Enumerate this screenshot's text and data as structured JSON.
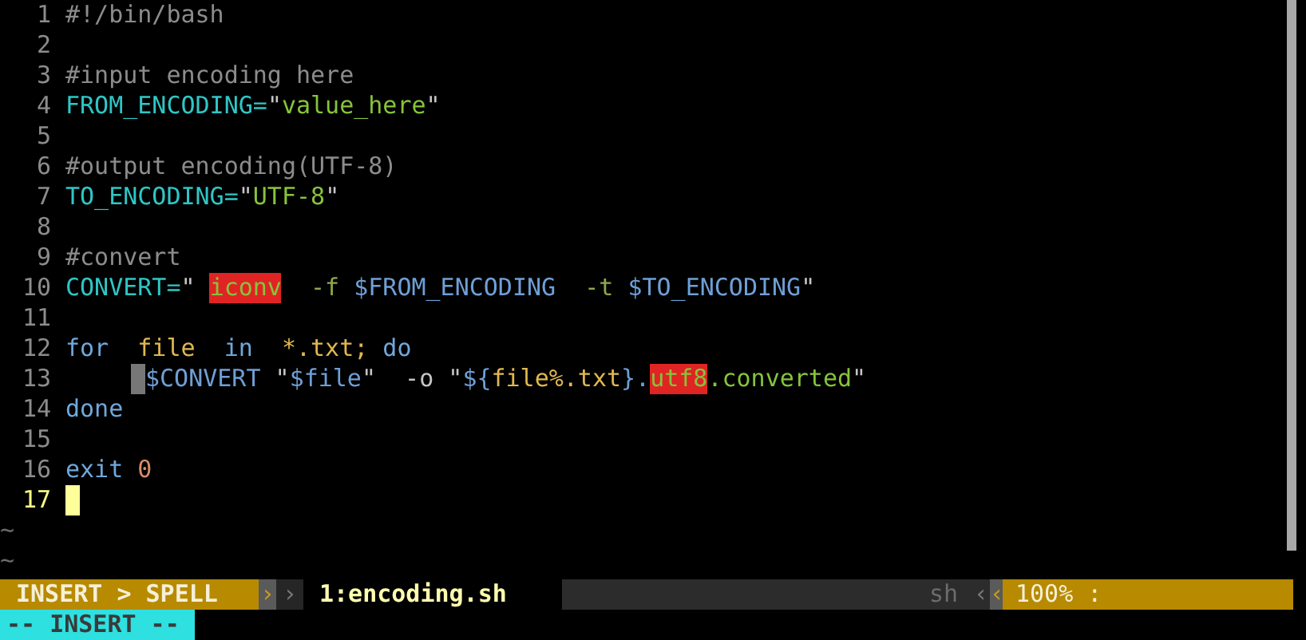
{
  "lines": [
    {
      "number": "1",
      "current": false,
      "tokens": [
        {
          "kind": "comment",
          "text": "#!/bin/bash"
        }
      ]
    },
    {
      "number": "2",
      "current": false
    },
    {
      "number": "3",
      "current": false,
      "tokens": [
        {
          "kind": "comment",
          "text": "#input encoding here"
        }
      ]
    },
    {
      "number": "4",
      "current": false,
      "tokens": [
        {
          "kind": "ident",
          "text": "FROM_ENCODING="
        },
        {
          "kind": "plain",
          "text": "\""
        },
        {
          "kind": "string",
          "text": "value_here"
        },
        {
          "kind": "plain",
          "text": "\""
        }
      ]
    },
    {
      "number": "5",
      "current": false
    },
    {
      "number": "6",
      "current": false,
      "tokens": [
        {
          "kind": "comment",
          "text": "#output encoding(UTF-8)"
        }
      ]
    },
    {
      "number": "7",
      "current": false,
      "tokens": [
        {
          "kind": "ident",
          "text": "TO_ENCODING="
        },
        {
          "kind": "plain",
          "text": "\""
        },
        {
          "kind": "string",
          "text": "UTF-8"
        },
        {
          "kind": "plain",
          "text": "\""
        }
      ]
    },
    {
      "number": "8",
      "current": false
    },
    {
      "number": "9",
      "current": false,
      "tokens": [
        {
          "kind": "comment",
          "text": "#convert"
        }
      ]
    },
    {
      "number": "10",
      "current": false,
      "tokens": [
        {
          "kind": "ident",
          "text": "CONVERT="
        },
        {
          "kind": "plain",
          "text": "\" "
        },
        {
          "kind": "spell_error",
          "text": "iconv"
        },
        {
          "kind": "option",
          "text": "  -f "
        },
        {
          "kind": "variable",
          "text": "$FROM_ENCODING"
        },
        {
          "kind": "option",
          "text": "  -t "
        },
        {
          "kind": "variable",
          "text": "$TO_ENCODING"
        },
        {
          "kind": "plain",
          "text": "\""
        }
      ]
    },
    {
      "number": "11",
      "current": false
    },
    {
      "number": "12",
      "current": false,
      "tokens": [
        {
          "kind": "keyword",
          "text": "for"
        },
        {
          "kind": "name",
          "text": "  file"
        },
        {
          "kind": "keyword",
          "text": "  in"
        },
        {
          "kind": "name",
          "text": "  *.txt;"
        },
        {
          "kind": "keyword",
          "text": " do"
        }
      ]
    },
    {
      "number": "13",
      "current": false,
      "indent_marker": true,
      "tokens": [
        {
          "kind": "variable",
          "text": "$CONVERT"
        },
        {
          "kind": "plain",
          "text": " \""
        },
        {
          "kind": "variable",
          "text": "$file"
        },
        {
          "kind": "plain",
          "text": "\"  -o \""
        },
        {
          "kind": "variable",
          "text": "${"
        },
        {
          "kind": "name",
          "text": "file%.txt"
        },
        {
          "kind": "variable",
          "text": "}."
        },
        {
          "kind": "spell_error",
          "text": "utf8"
        },
        {
          "kind": "string",
          "text": ".converted"
        },
        {
          "kind": "plain",
          "text": "\""
        }
      ]
    },
    {
      "number": "14",
      "current": false,
      "tokens": [
        {
          "kind": "keyword",
          "text": "done"
        }
      ]
    },
    {
      "number": "15",
      "current": false
    },
    {
      "number": "16",
      "current": false,
      "tokens": [
        {
          "kind": "keyword",
          "text": "exit"
        },
        {
          "kind": "number",
          "text": " 0"
        }
      ]
    },
    {
      "number": "17",
      "current": true,
      "cursor": true
    }
  ],
  "filler_lines": [
    "~",
    "~"
  ],
  "status_line": {
    "mode": "INSERT > SPELL",
    "left_separators": [
      "›",
      "›"
    ],
    "file": "1:encoding.sh",
    "filetype": "sh",
    "right_separators": [
      "‹",
      "‹"
    ],
    "position": "100% :"
  },
  "command_line": "-- INSERT --"
}
